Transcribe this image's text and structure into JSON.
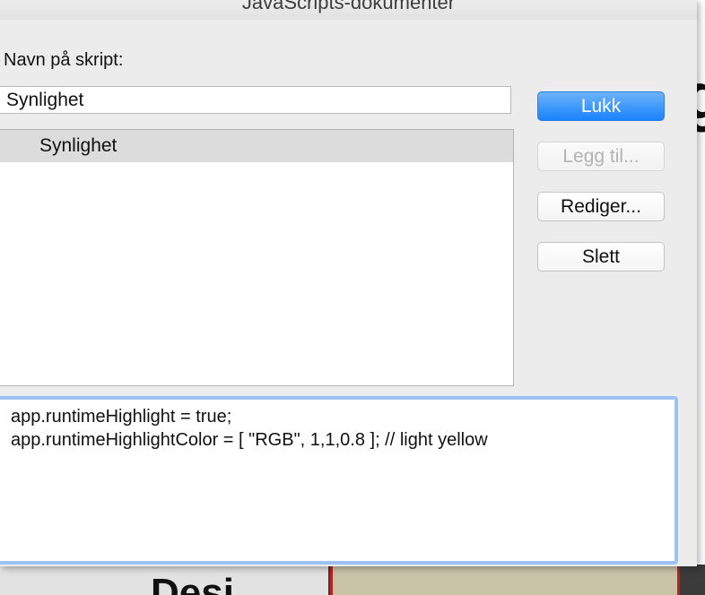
{
  "window": {
    "title": "JavaScripts-dokumenter"
  },
  "form": {
    "name_label": "Navn på skript:",
    "name_value": "Synlighet"
  },
  "script_list": {
    "items": [
      {
        "label": "Synlighet",
        "selected": true
      }
    ]
  },
  "buttons": {
    "close": "Lukk",
    "add": "Legg til...",
    "edit": "Rediger...",
    "delete": "Slett"
  },
  "editor": {
    "code": "app.runtimeHighlight = true;\napp.runtimeHighlightColor = [ \"RGB\", 1,1,0.8 ]; // light yellow"
  },
  "background": {
    "right_fragment": "g",
    "bottom_fragment": "Desi"
  },
  "colors": {
    "primary_button": "#1a82fb",
    "focus_ring": "#9cc3f2",
    "dialog_bg": "#ececec"
  }
}
